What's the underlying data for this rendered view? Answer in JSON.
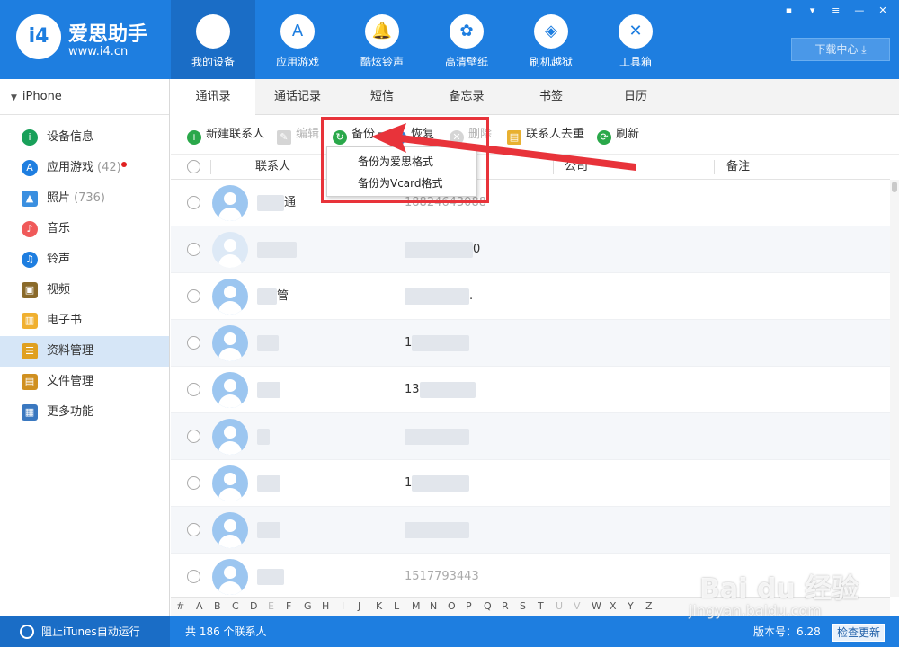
{
  "app": {
    "logo_text": "爱思助手",
    "logo_mark": "i4",
    "url": "www.i4.cn",
    "download_center": "下载中心"
  },
  "nav": [
    {
      "label": "我的设备",
      "icon": "apple-icon",
      "active": true
    },
    {
      "label": "应用游戏",
      "icon": "app-store-icon"
    },
    {
      "label": "酷炫铃声",
      "icon": "bell-icon"
    },
    {
      "label": "高清壁纸",
      "icon": "flower-icon"
    },
    {
      "label": "刷机越狱",
      "icon": "box-icon"
    },
    {
      "label": "工具箱",
      "icon": "tools-icon"
    }
  ],
  "sidebar": {
    "device": "iPhone",
    "items": [
      {
        "label": "设备信息",
        "icon": "info-icon",
        "color": "#19a05a"
      },
      {
        "label": "应用游戏",
        "count": "(42)",
        "icon": "app-store-icon",
        "color": "#1e7ee0",
        "badge": true
      },
      {
        "label": "照片",
        "count": "(736)",
        "icon": "photo-icon",
        "color": "#3a8fe0"
      },
      {
        "label": "音乐",
        "icon": "music-icon",
        "color": "#f05a5a"
      },
      {
        "label": "铃声",
        "icon": "bell-icon",
        "color": "#1e7ee0"
      },
      {
        "label": "视频",
        "icon": "film-icon",
        "color": "#8a6a2a"
      },
      {
        "label": "电子书",
        "icon": "book-icon",
        "color": "#f0b030"
      },
      {
        "label": "资料管理",
        "icon": "contacts-icon",
        "color": "#e0a020",
        "active": true
      },
      {
        "label": "文件管理",
        "icon": "file-icon",
        "color": "#d09020"
      },
      {
        "label": "更多功能",
        "icon": "more-icon",
        "color": "#3a78c0"
      }
    ]
  },
  "tabs": [
    "通讯录",
    "通话记录",
    "短信",
    "备忘录",
    "书签",
    "日历"
  ],
  "toolbar": {
    "new_contact": "新建联系人",
    "edit": "编辑",
    "backup": "备份",
    "restore": "恢复",
    "delete": "删除",
    "dedupe": "联系人去重",
    "refresh": "刷新"
  },
  "columns": {
    "contact": "联系人",
    "company": "公司",
    "note": "备注"
  },
  "dropdown": [
    "备份为爱思格式",
    "备份为Vcard格式"
  ],
  "rows": [
    {
      "name": "通",
      "phone": "18824643088"
    },
    {
      "name": "",
      "phone": "0"
    },
    {
      "name": "管",
      "phone": "."
    },
    {
      "name": "",
      "phone": "1"
    },
    {
      "name": "",
      "phone": "13"
    },
    {
      "name": "",
      "phone": ""
    },
    {
      "name": "",
      "phone": "1"
    },
    {
      "name": "",
      "phone": ""
    },
    {
      "name": "",
      "phone": "1517793443"
    }
  ],
  "alphabet": [
    "#",
    "A",
    "B",
    "C",
    "D",
    "E",
    "F",
    "G",
    "H",
    "I",
    "J",
    "K",
    "L",
    "M",
    "N",
    "O",
    "P",
    "Q",
    "R",
    "S",
    "T",
    "U",
    "V",
    "W",
    "X",
    "Y",
    "Z"
  ],
  "alphabet_dim": [
    "E",
    "I",
    "U",
    "V"
  ],
  "status": {
    "itunes": "阻止iTunes自动运行",
    "total": "共 186 个联系人",
    "version": "版本号：6.28",
    "check_update": "检查更新"
  },
  "watermark": {
    "brand": "Bai du 经验",
    "url": "jingyan.baidu.com"
  },
  "colors": {
    "brand_blue": "#1e7ee0",
    "highlight_red": "#e8333a"
  }
}
